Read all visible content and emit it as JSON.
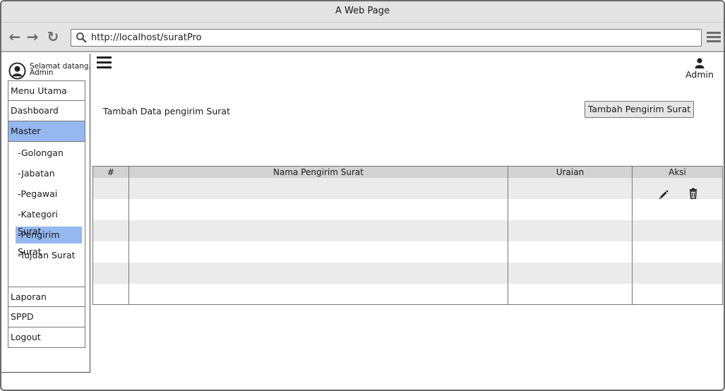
{
  "window": {
    "title": "A Web Page"
  },
  "browser": {
    "url": "http://localhost/suratPro"
  },
  "sidebar": {
    "welcome": [
      "Selamat datang,",
      "Admin"
    ],
    "menu": [
      {
        "label": "Menu Utama"
      },
      {
        "label": "Dashboard"
      },
      {
        "label": "Master",
        "active": true
      }
    ],
    "submenu": [
      {
        "label": "-Golongan"
      },
      {
        "label": "-Jabatan"
      },
      {
        "label": "-Pegawai"
      },
      {
        "label": "-Kategori Surat"
      },
      {
        "label": "-Pengirim Surat",
        "active": true
      },
      {
        "label": "-Tujuan Surat"
      }
    ],
    "menu_bottom": [
      {
        "label": "Laporan"
      },
      {
        "label": "SPPD"
      },
      {
        "label": "Logout"
      }
    ]
  },
  "header": {
    "user_label": "Admin"
  },
  "main": {
    "title": "Tambah Data pengirim Surat",
    "add_button": "Tambah Pengirim Surat",
    "table": {
      "columns": [
        "#",
        "Nama Pengirim Surat",
        "Uraian",
        "Aksi"
      ],
      "rows": [
        {
          "no": "",
          "nama": "",
          "uraian": "",
          "actions": [
            "edit-icon",
            "delete-icon"
          ]
        },
        {
          "no": "",
          "nama": "",
          "uraian": ""
        },
        {
          "no": "",
          "nama": "",
          "uraian": ""
        },
        {
          "no": "",
          "nama": "",
          "uraian": ""
        },
        {
          "no": "",
          "nama": "",
          "uraian": ""
        },
        {
          "no": "",
          "nama": "",
          "uraian": ""
        }
      ]
    }
  },
  "colors": {
    "active_bg": "#94b8ef",
    "header_bg": "#d2d2d2",
    "stripe_bg": "#ebebeb"
  }
}
